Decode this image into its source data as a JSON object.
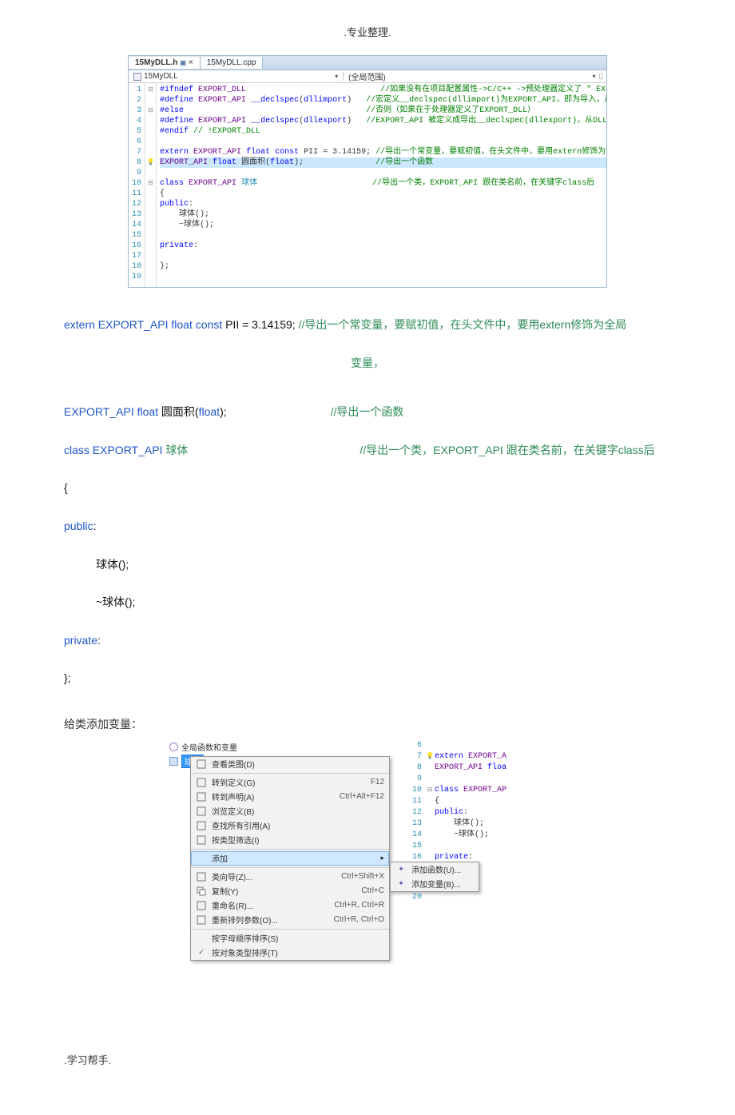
{
  "header": {
    "title": ".专业整理."
  },
  "footer": {
    "text": ".学习帮手."
  },
  "ide": {
    "tabs": [
      {
        "name": "15MyDLL.h",
        "active": true,
        "pinned": true,
        "closable": true
      },
      {
        "name": "15MyDLL.cpp",
        "active": false
      }
    ],
    "scope_left": "15MyDLL",
    "scope_right": "(全局范围)",
    "lines": [
      {
        "n": 1,
        "margin": "▢-",
        "html": "<span class='c-key'>#ifndef</span> <span class='c-macro'>EXPORT_DLL</span>                            <span class='c-cmt'>//如果没有在项目配置属性-&gt;C/C++ -&gt;预处理器定义了 \" EXPORT_DLL \"</span>"
      },
      {
        "n": 2,
        "html": "<span class='c-key'>#define</span> <span class='c-macro'>EXPORT_API</span> <span class='c-key'>__declspec</span>(<span class='c-key'>dllimport</span>)   <span class='c-cmt'>//宏定义__declspec(dllimport)为EXPORT_API，即为导入，从DLL中导入到</span>"
      },
      {
        "n": 3,
        "margin": "▢-",
        "html": "<span class='c-key'>#else</span>                                      <span class='c-cmt'>//否则（如果在于处理器定义了EXPORT_DLL）</span>"
      },
      {
        "n": 4,
        "html": "<span class='c-key'>#define</span> <span class='c-macro'>EXPORT_API</span> <span class='c-key'>__declspec</span>(<span class='c-key'>dllexport</span>)   <span class='c-cmt'>//EXPORT_API 被定义成导出__declspec(dllexport)，从DLL中输出变量、</span>"
      },
      {
        "n": 5,
        "html": "<span class='c-key'>#endif</span> <span class='c-cmt'>// !EXPORT_DLL</span>"
      },
      {
        "n": 6,
        "html": ""
      },
      {
        "n": 7,
        "html": "<span class='c-key'>extern</span> <span class='c-macro'>EXPORT_API</span> <span class='c-key'>float</span> <span class='c-key'>const</span> PII = 3.14159; <span class='c-cmt'>//导出一个常变量，要赋初值，在头文件中，要用extern修饰为全局变</span>"
      },
      {
        "n": 8,
        "margin": "bulb",
        "hl": true,
        "html": "<span class='c-macro'>EXPORT_API</span> <span class='c-key'>float</span> 圆面积(<span class='c-key'>float</span>);               <span class='c-cmt'>//导出一个函数</span>"
      },
      {
        "n": 9,
        "html": ""
      },
      {
        "n": 10,
        "margin": "▢-",
        "html": "<span class='c-key'>class</span> <span class='c-macro'>EXPORT_API</span> <span class='c-type'>球体</span>                        <span class='c-cmt'>//导出一个类，EXPORT_API 跟在类名前，在关键字class后</span>"
      },
      {
        "n": 11,
        "html": "{"
      },
      {
        "n": 12,
        "html": "<span class='c-key'>public</span>:"
      },
      {
        "n": 13,
        "html": "    球体();"
      },
      {
        "n": 14,
        "html": "    ~球体();"
      },
      {
        "n": 15,
        "html": ""
      },
      {
        "n": 16,
        "html": "<span class='c-key'>private</span>:"
      },
      {
        "n": 17,
        "html": ""
      },
      {
        "n": 18,
        "html": "};"
      },
      {
        "n": 19,
        "html": ""
      }
    ]
  },
  "explain": {
    "row1_pre": "extern",
    "row1_api": " EXPORT_API ",
    "row1_type": "float const",
    "row1_rest": " PII = 3.14159; ",
    "row1_cmt": "//导出一个常变量，要赋初值，在头文件中，要用extern修饰为全局",
    "row1b": "变量，",
    "row2_api": "EXPORT_API ",
    "row2_type": "float",
    "row2_rest": "  圆面积(",
    "row2_float": "float",
    "row2_close": ");",
    "row2_cmt": "//导出一个函数",
    "row3_class": "class",
    "row3_api": " EXPORT_API ",
    "row3_name": " 球体",
    "row3_cmt": "//导出一个类，EXPORT_API 跟在类名前，在关键字class后",
    "row4": "{",
    "row5": "public",
    "row5_colon": ":",
    "row6": "球体();",
    "row7": "~球体();",
    "row8": "private",
    "row8_colon": ":",
    "row9": "};"
  },
  "subhead": {
    "text": "给类添加变量："
  },
  "tree": {
    "items": [
      {
        "label": "全局函数和变量",
        "icon": "globe"
      },
      {
        "label": "球体",
        "icon": "class",
        "selected": true
      }
    ]
  },
  "contextMenu": {
    "items": [
      {
        "label": "查看类图(D)",
        "icon": "class-diagram-icon"
      },
      {
        "sep": true
      },
      {
        "label": "转到定义(G)",
        "shortcut": "F12",
        "icon": "goto-def-icon"
      },
      {
        "label": "转到声明(A)",
        "shortcut": "Ctrl+Alt+F12",
        "icon": "goto-decl-icon"
      },
      {
        "label": "浏览定义(B)",
        "icon": "browse-def-icon"
      },
      {
        "label": "查找所有引用(A)",
        "icon": "find-refs-icon"
      },
      {
        "label": "按类型筛选(I)",
        "icon": "filter-icon"
      },
      {
        "sep": true
      },
      {
        "label": "添加",
        "hover": true,
        "submenu": true
      },
      {
        "sep": true
      },
      {
        "label": "类向导(Z)...",
        "shortcut": "Ctrl+Shift+X",
        "icon": "class-wizard-icon"
      },
      {
        "label": "复制(Y)",
        "shortcut": "Ctrl+C",
        "icon": "copy-icon"
      },
      {
        "label": "重命名(R)...",
        "shortcut": "Ctrl+R, Ctrl+R",
        "icon": "rename-icon"
      },
      {
        "label": "重新排列参数(O)...",
        "shortcut": "Ctrl+R, Ctrl+O",
        "icon": "reorder-icon"
      },
      {
        "sep": true
      },
      {
        "label": "按字母顺序排序(S)"
      },
      {
        "label": "按对象类型排序(T)",
        "icon": "check-icon"
      }
    ]
  },
  "submenu": {
    "items": [
      {
        "label": "添加函数(U)...",
        "icon": "add-func-icon"
      },
      {
        "label": "添加变量(B)...",
        "icon": "add-var-icon"
      }
    ]
  },
  "rightcode": {
    "lines": [
      {
        "n": 6,
        "html": ""
      },
      {
        "n": 7,
        "margin": "bulb",
        "html": "<span class='c-key'>extern</span> <span class='c-macro'>EXPORT_A</span>"
      },
      {
        "n": 8,
        "html": "<span class='c-macro'>EXPORT_API</span> <span class='c-key'>floa</span>"
      },
      {
        "n": 9,
        "html": ""
      },
      {
        "n": 10,
        "margin": "▢-",
        "html": "<span class='c-key'>class</span> <span class='c-macro'>EXPORT_AP</span>"
      },
      {
        "n": 11,
        "html": "{"
      },
      {
        "n": 12,
        "html": "<span class='c-key'>public</span>:"
      },
      {
        "n": 13,
        "html": "    球体();"
      },
      {
        "n": 14,
        "html": "    ~球体();"
      },
      {
        "n": 15,
        "html": ""
      },
      {
        "n": 16,
        "html": "<span class='c-key'>private</span>:"
      },
      {
        "n": 20,
        "skip": true,
        "html": ""
      }
    ]
  }
}
